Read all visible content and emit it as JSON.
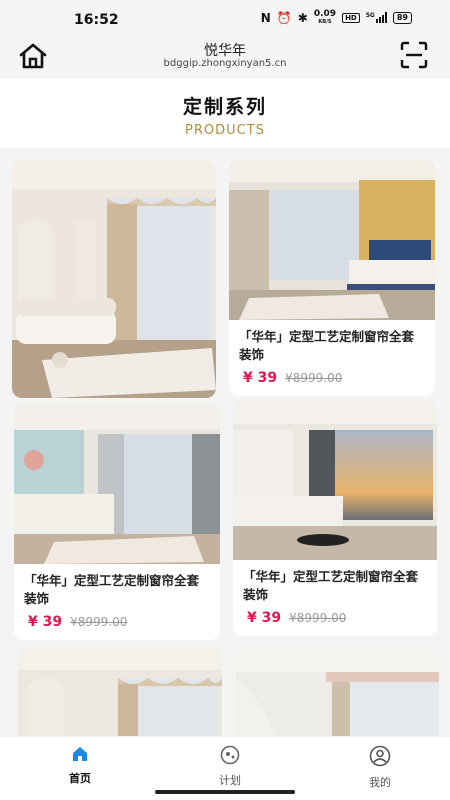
{
  "status_bar": {
    "time": "16:52",
    "nfc": "N",
    "alarm": "⏰",
    "bluetooth": "✱",
    "net_speed_value": "0.09",
    "net_speed_unit": "KB/S",
    "hd": "HD",
    "signal_label": "5G",
    "battery": "89"
  },
  "browser": {
    "title": "悦华年",
    "url": "bdggip.zhongxinyan5.cn"
  },
  "section": {
    "title": "定制系列",
    "subtitle": "PRODUCTS"
  },
  "products": [
    {
      "title": "",
      "price": "",
      "old_price": ""
    },
    {
      "title": "「华年」定型工艺定制窗帘全套装饰",
      "price": "¥ 39",
      "old_price": "¥8999.00"
    },
    {
      "title": "「华年」定型工艺定制窗帘全套装饰",
      "price": "¥ 39",
      "old_price": "¥8999.00"
    },
    {
      "title": "「华年」定型工艺定制窗帘全套装饰",
      "price": "¥ 39",
      "old_price": "¥8999.00"
    }
  ],
  "tabs": [
    {
      "label": "首页",
      "icon": "home-icon",
      "active": true
    },
    {
      "label": "计划",
      "icon": "plan-icon",
      "active": false
    },
    {
      "label": "我的",
      "icon": "profile-icon",
      "active": false
    }
  ],
  "colors": {
    "accent_price": "#e0174e",
    "subtitle_gold": "#b28a3e",
    "active_tab": "#1e88e5"
  }
}
